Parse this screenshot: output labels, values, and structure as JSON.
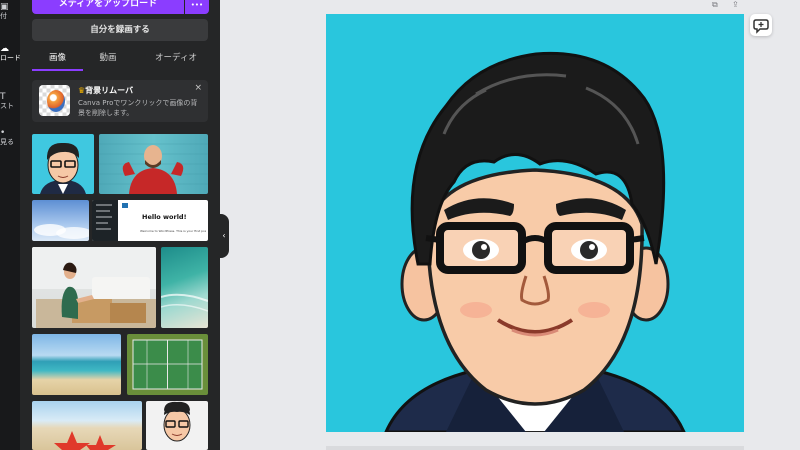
{
  "rail": {
    "items": [
      {
        "label": "付",
        "icon": "template-icon"
      },
      {
        "label": "ロード",
        "icon": "upload-icon"
      },
      {
        "label": "スト",
        "icon": "text-icon"
      },
      {
        "label": "見る",
        "icon": "more-icon"
      }
    ]
  },
  "panel": {
    "upload_label": "メディアをアップロード",
    "more_label": "•••",
    "record_label": "自分を録画する",
    "tabs": [
      {
        "label": "画像"
      },
      {
        "label": "動画"
      },
      {
        "label": "オーディオ"
      }
    ],
    "active_tab": "画像",
    "promo": {
      "title": "背景リムーバ",
      "description": "Canva Proでワンクリックで画像の背景を削除します。",
      "close": "×"
    },
    "thumbnails": [
      {
        "name": "caricature-man"
      },
      {
        "name": "man-red-sweater"
      },
      {
        "name": "blue-sky-clouds"
      },
      {
        "name": "hello-world-screenshot",
        "heading": "Hello world!",
        "body": "Welcome to WordPress. This is your first post. Edit or delete it"
      },
      {
        "name": "woman-packing-boxes"
      },
      {
        "name": "ocean-aerial"
      },
      {
        "name": "beach-shore"
      },
      {
        "name": "tennis-court-aerial"
      },
      {
        "name": "starfish-beach"
      },
      {
        "name": "caricature-man-small"
      }
    ]
  },
  "canvas": {
    "background_color": "#29c6dd",
    "collapse_icon": "‹"
  },
  "colors": {
    "accent": "#8b3dff",
    "panel_bg": "#252627",
    "rail_bg": "#18191b",
    "workspace_bg": "#e8e9ec"
  }
}
